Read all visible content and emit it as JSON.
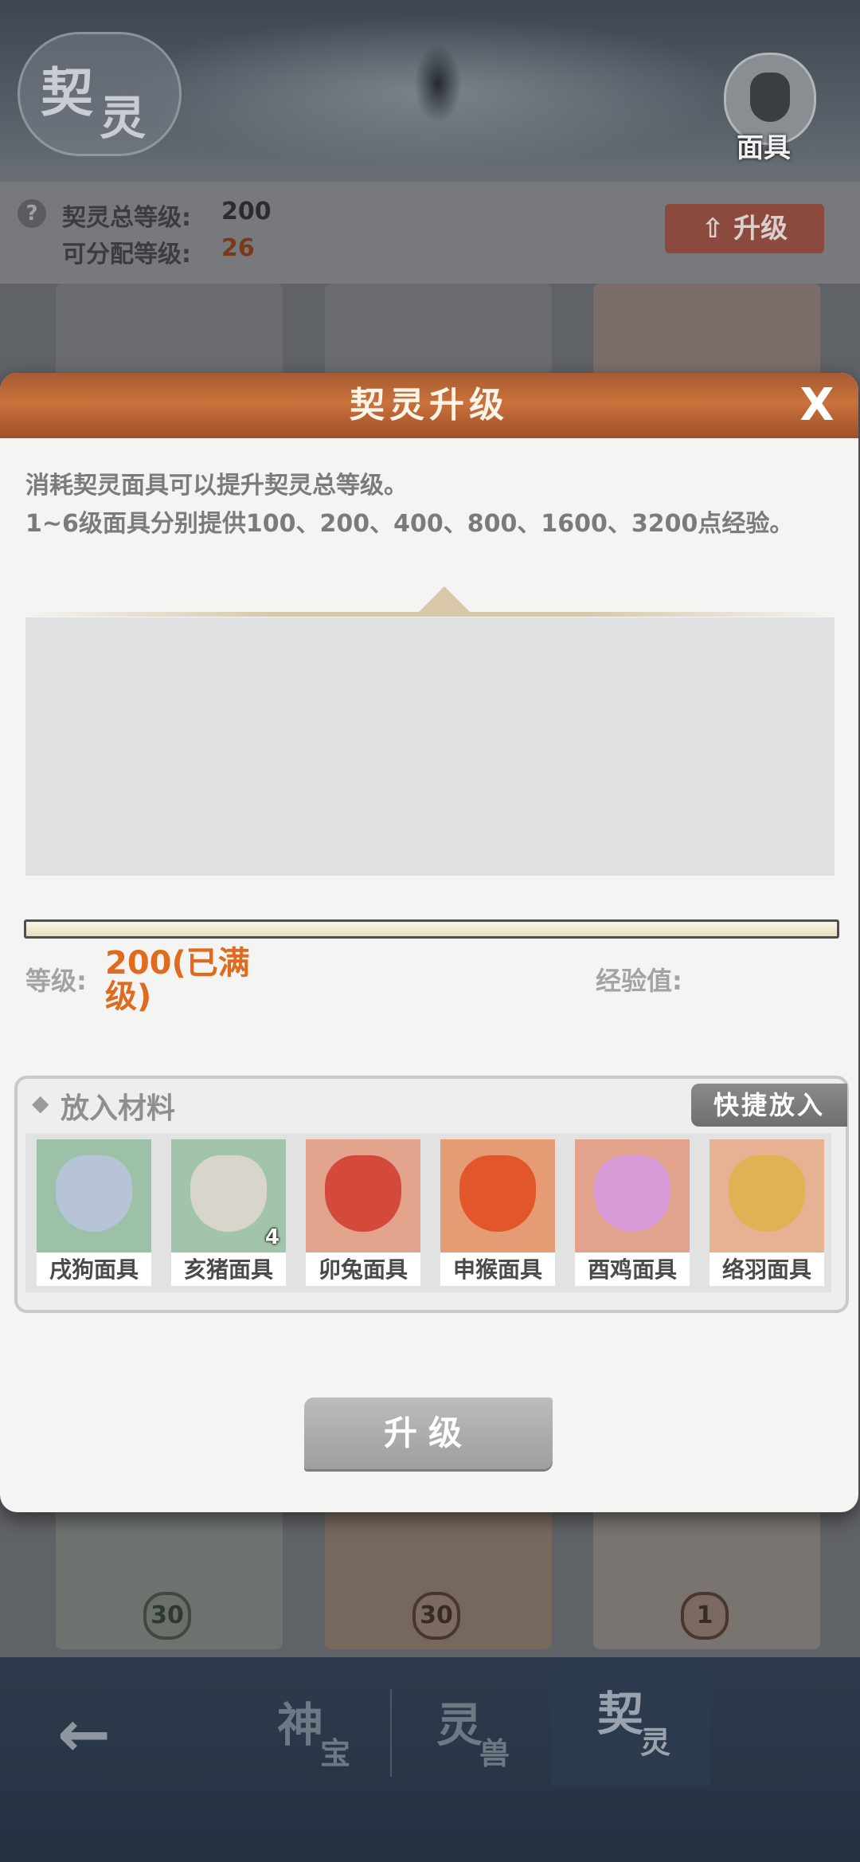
{
  "header": {
    "logo_char1": "契",
    "logo_char2": "灵",
    "mask_button_label": "面具"
  },
  "info": {
    "help_icon": "?",
    "total_level_label": "契灵总等级:",
    "total_level_value": "200",
    "allocatable_label": "可分配等级:",
    "allocatable_value": "26",
    "upgrade_label": "升级"
  },
  "cards": {
    "row2_levels": [
      "30",
      "30",
      "1"
    ]
  },
  "dialog": {
    "title": "契灵升级",
    "close_label": "X",
    "desc_line1": "消耗契灵面具可以提升契灵总等级。",
    "desc_line2": "1~6级面具分别提供100、200、400、800、1600、3200点经验。",
    "level_label": "等级:",
    "level_value": "200(已满级)",
    "exp_label": "经验值:",
    "materials": {
      "header": "放入材料",
      "quick_button": "快捷放入",
      "items": [
        {
          "name": "戌狗面具",
          "count": "",
          "bg": "#9cc1a6",
          "color": "#b7c3d6"
        },
        {
          "name": "亥猪面具",
          "count": "4",
          "bg": "#a2c4aa",
          "color": "#d8d6cc"
        },
        {
          "name": "卯兔面具",
          "count": "",
          "bg": "#e2a48c",
          "color": "#d34a3a"
        },
        {
          "name": "申猴面具",
          "count": "",
          "bg": "#e59b74",
          "color": "#e2562c"
        },
        {
          "name": "酉鸡面具",
          "count": "",
          "bg": "#e3a28c",
          "color": "#d69ad6"
        },
        {
          "name": "络羽面具",
          "count": "",
          "bg": "#e6b293",
          "color": "#e0b255"
        }
      ]
    },
    "upgrade_button": "升级"
  },
  "bottom_nav": {
    "back_icon": "←",
    "tabs": [
      {
        "big": "神",
        "small": "宝"
      },
      {
        "big": "灵",
        "small": "兽"
      },
      {
        "big": "契",
        "small": "灵"
      }
    ]
  }
}
